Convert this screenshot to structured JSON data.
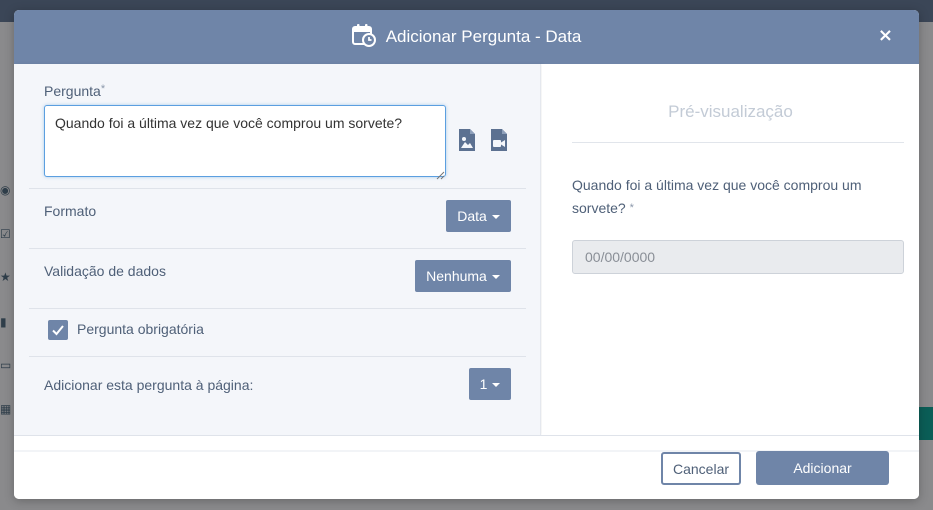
{
  "modal": {
    "title": "Adicionar Pergunta - Data",
    "title_icon": "calendar-clock-icon",
    "close_label": "×"
  },
  "form": {
    "question_label": "Pergunta",
    "required_mark": "*",
    "question_value": "Quando foi a última vez que você comprou um sorvete?",
    "image_icon": "image-file-icon",
    "video_icon": "video-file-icon",
    "format_label": "Formato",
    "format_value": "Data",
    "validation_label": "Validação de dados",
    "validation_value": "Nenhuma",
    "required_checkbox_label": "Pergunta obrigatória",
    "required_checked": true,
    "page_label": "Adicionar esta pergunta à página:",
    "page_value": "1"
  },
  "preview": {
    "title": "Pré-visualização",
    "question_text": "Quando foi a última vez que você comprou um sorvete?",
    "required_mark": "*",
    "date_placeholder": "00/00/0000"
  },
  "footer": {
    "cancel_label": "Cancelar",
    "add_label": "Adicionar"
  },
  "colors": {
    "header": "#6f85a8",
    "accent": "#6f85a8",
    "text": "#4f6078",
    "focus_border": "#5b9fe0"
  }
}
